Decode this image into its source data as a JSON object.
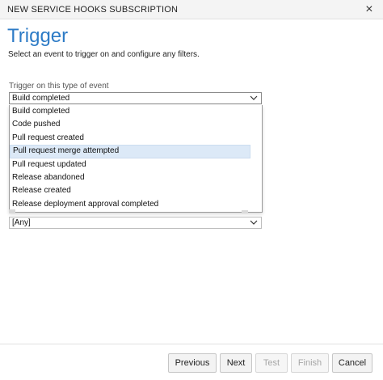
{
  "window": {
    "title": "NEW SERVICE HOOKS SUBSCRIPTION"
  },
  "page": {
    "heading": "Trigger",
    "subtitle": "Select an event to trigger on and configure any filters."
  },
  "event_field": {
    "label": "Trigger on this type of event",
    "selected": "Build completed",
    "options": [
      "Build completed",
      "Code pushed",
      "Pull request created",
      "Pull request merge attempted",
      "Pull request updated",
      "Release abandoned",
      "Release created",
      "Release deployment approval completed"
    ],
    "hovered_option": "Pull request merge attempted"
  },
  "filter_field": {
    "selected": "[Any]"
  },
  "footer": {
    "previous_label": "Previous",
    "next_label": "Next",
    "test_label": "Test",
    "finish_label": "Finish",
    "cancel_label": "Cancel"
  },
  "colors": {
    "heading": "#2d7bc6",
    "hover_row": "#dce9f7"
  }
}
